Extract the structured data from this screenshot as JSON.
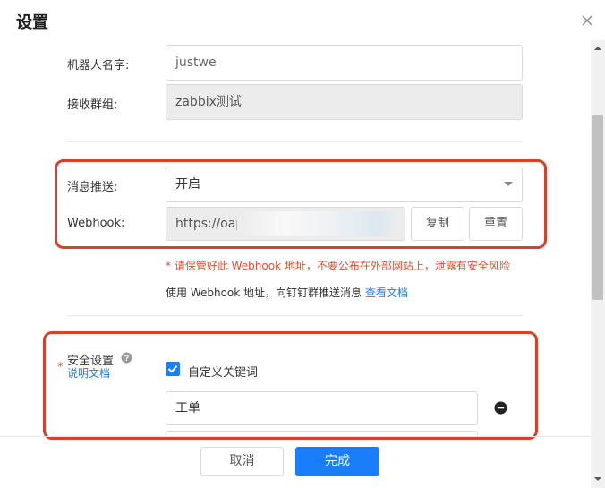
{
  "dialog": {
    "title": "设置"
  },
  "form": {
    "robot_name_label": "机器人名字:",
    "robot_name_value": "justwe",
    "group_label": "接收群组:",
    "group_value": "zabbix测试",
    "push_label": "消息推送:",
    "push_value": "开启",
    "webhook_label": "Webhook:",
    "webhook_value": "https://oap",
    "copy_label": "复制",
    "reset_label": "重置",
    "warning": "* 请保管好此 Webhook 地址，不要公布在外部网站上，泄露有安全风险",
    "usage_text": "使用 Webhook 地址，向钉钉群推送消息",
    "view_docs": "查看文档",
    "security_label": "安全设置",
    "security_docs": "说明文档",
    "keyword_checkbox_label": "自定义关键词",
    "keyword_checked": true,
    "keyword_value": "工单"
  },
  "footer": {
    "cancel_label": "取消",
    "done_label": "完成"
  },
  "colors": {
    "primary": "#1a7dfa",
    "danger": "#e64a2e",
    "highlight_box": "#d9402b"
  }
}
